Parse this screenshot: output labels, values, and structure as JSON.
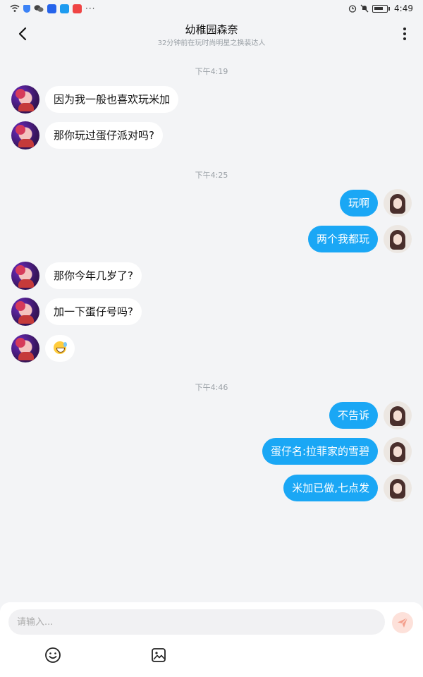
{
  "status_bar": {
    "time": "4:49"
  },
  "header": {
    "title": "幼稚园森奈",
    "subtitle": "32分钟前在玩时尚明星之换装达人"
  },
  "timestamps": [
    "下午4:19",
    "下午4:25",
    "下午4:46"
  ],
  "messages": [
    {
      "from": "other",
      "text": "因为我一般也喜欢玩米加"
    },
    {
      "from": "other",
      "text": "那你玩过蛋仔派对吗?"
    },
    {
      "from": "me",
      "text": "玩啊"
    },
    {
      "from": "me",
      "text": "两个我都玩"
    },
    {
      "from": "other",
      "text": "那你今年几岁了?"
    },
    {
      "from": "other",
      "text": "加一下蛋仔号吗?"
    },
    {
      "from": "other",
      "text": "",
      "emoji": "sweat-smile-emoji"
    },
    {
      "from": "me",
      "text": "不告诉"
    },
    {
      "from": "me",
      "text": "蛋仔名:拉菲家的雪碧"
    },
    {
      "from": "me",
      "text": "米加已做,七点发"
    }
  ],
  "composer": {
    "placeholder": "请输入..."
  },
  "icons": {
    "back": "chevron-left-icon",
    "more": "more-vertical-icon",
    "send": "send-icon",
    "emoji": "smiley-icon",
    "image": "image-icon"
  },
  "colors": {
    "my_bubble": "#1aa7f5",
    "other_bubble": "#ffffff",
    "background": "#f3f4f6",
    "send_button": "#fde1da"
  }
}
